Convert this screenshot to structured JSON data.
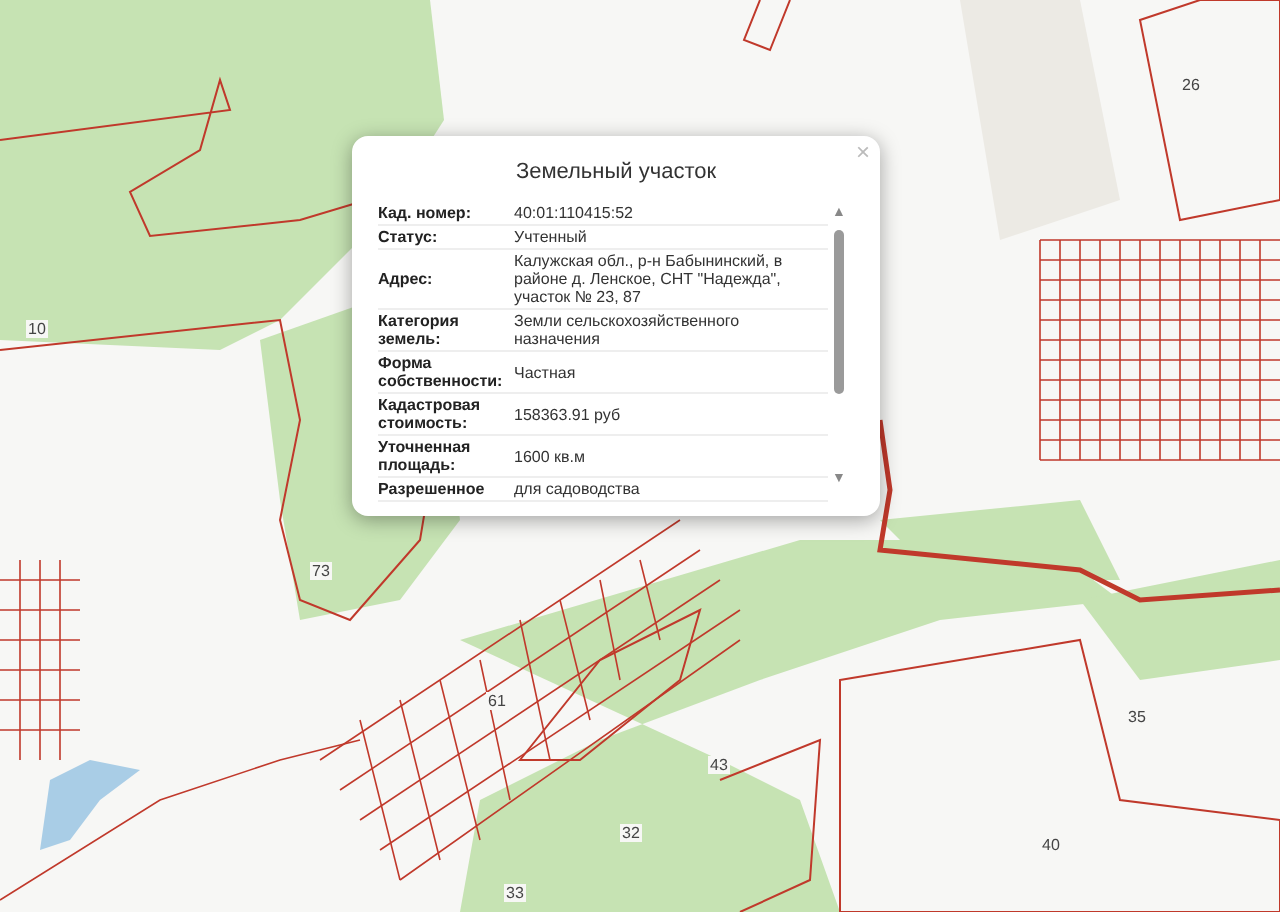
{
  "map": {
    "plot_labels": [
      "26",
      "10",
      "73",
      "61",
      "35",
      "40",
      "33",
      "32",
      "43"
    ]
  },
  "popup": {
    "title": "Земельный участок",
    "close": "×",
    "scroll_up": "▲",
    "scroll_down": "▼",
    "rows": [
      {
        "label": "Кад. номер:",
        "value": "40:01:110415:52"
      },
      {
        "label": "Статус:",
        "value": "Учтенный"
      },
      {
        "label": "Адрес:",
        "value": "Калужская обл., р-н Бабынинский, в районе д. Ленское, СНТ \"Надежда\", участок № 23, 87"
      },
      {
        "label": "Категория земель:",
        "value": "Земли сельскохозяйственного назначения"
      },
      {
        "label": "Форма собственности:",
        "value": "Частная"
      },
      {
        "label": "Кадастровая стоимость:",
        "value": "158363.91 руб"
      },
      {
        "label": "Уточненная площадь:",
        "value": "1600 кв.м"
      },
      {
        "label": "Разрешенное",
        "value": "для садоводства"
      }
    ]
  }
}
